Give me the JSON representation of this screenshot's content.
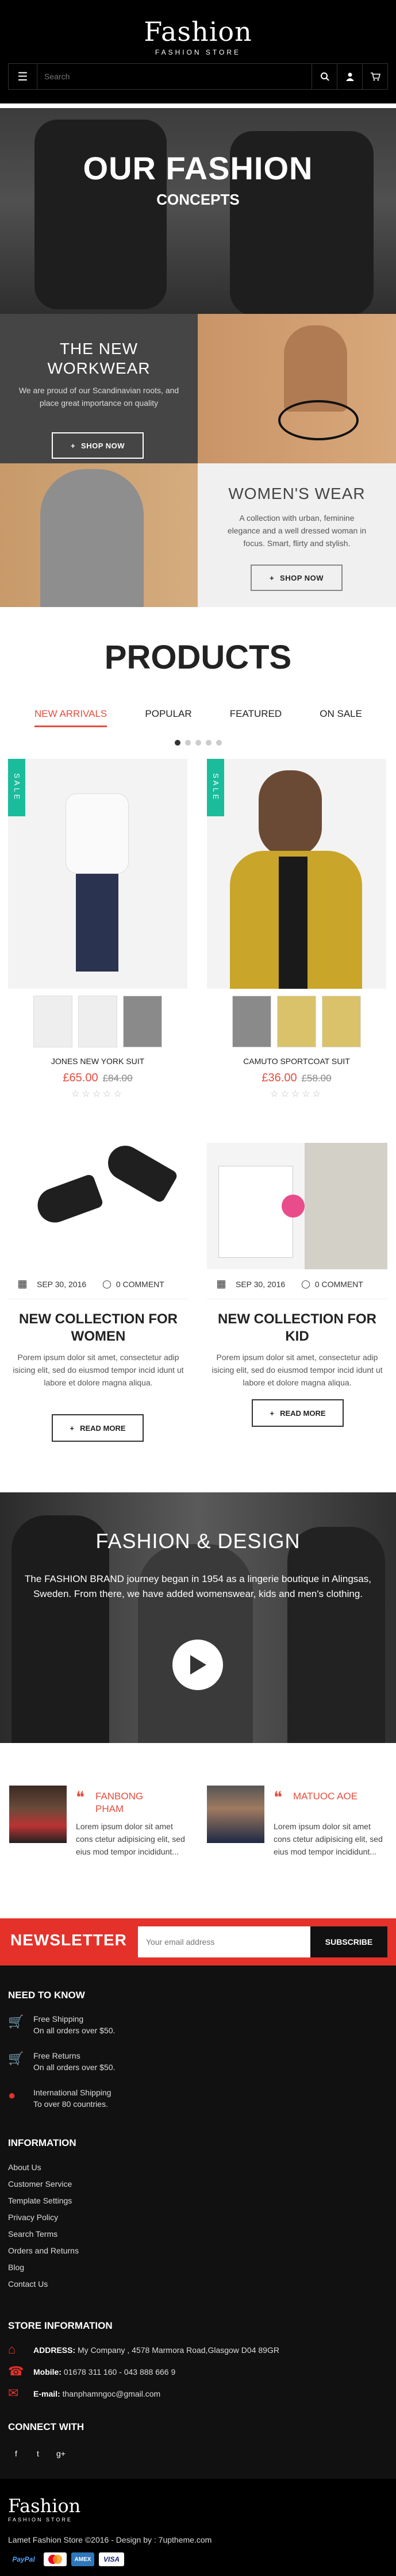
{
  "header": {
    "logo_word": "Fashion",
    "logo_sub": "FASHION STORE",
    "search_placeholder": "Search"
  },
  "hero": {
    "title": "OUR FASHION",
    "subtitle": "CONCEPTS"
  },
  "promo1": {
    "title_line1": "THE NEW",
    "title_line2": "WORKWEAR",
    "text": "We are proud of our Scandinavian roots, and place great importance on quality",
    "button": "SHOP NOW"
  },
  "promo2": {
    "title": "WOMEN'S WEAR",
    "text": "A collection with urban, feminine elegance and a well dressed woman in focus. Smart, flirty and stylish.",
    "button": "SHOP NOW"
  },
  "products": {
    "title": "PRODUCTS",
    "tabs": [
      "NEW ARRIVALS",
      "POPULAR",
      "FEATURED",
      "ON SALE"
    ],
    "sale_label": "SALE",
    "items": [
      {
        "name": "JONES NEW YORK SUIT",
        "price": "£65.00",
        "old_price": "£84.00"
      },
      {
        "name": "CAMUTO SPORTCOAT SUIT",
        "price": "£36.00",
        "old_price": "£58.00"
      }
    ],
    "stars": "☆☆☆☆☆"
  },
  "blog": [
    {
      "date": "SEP 30, 2016",
      "comments": "0 COMMENT",
      "title_line1": "NEW COLLECTION FOR",
      "title_line2": "WOMEN",
      "text": "Porem ipsum dolor sit amet, consectetur adip isicing elit, sed do eiusmod tempor incid idunt ut labore et dolore magna aliqua.",
      "button": "READ MORE"
    },
    {
      "date": "SEP 30, 2016",
      "comments": "0 COMMENT",
      "title_line1": "NEW COLLECTION FOR KID",
      "title_line2": "",
      "text": "Porem ipsum dolor sit amet, consectetur adip isicing elit, sed do eiusmod tempor incid idunt ut labore et dolore magna aliqua.",
      "button": "READ MORE"
    }
  ],
  "fashion_design": {
    "title": "FASHION & DESIGN",
    "text": "The FASHION BRAND journey began in 1954 as a lingerie boutique in Alingsas, Sweden. From there, we have added womenswear, kids and men's clothing."
  },
  "testimonials": [
    {
      "name_line1": "FANBONG",
      "name_line2": "PHAM",
      "text": "Lorem ipsum dolor sit amet cons ctetur adipisicing elit, sed eius mod tempor incididunt..."
    },
    {
      "name_line1": "MATUOC AOE",
      "name_line2": "",
      "text": "Lorem ipsum dolor sit amet cons ctetur adipisicing elit, sed eius mod tempor incididunt..."
    }
  ],
  "newsletter": {
    "label": "NEWSLETTER",
    "placeholder": "Your email address",
    "button": "SUBSCRIBE"
  },
  "footer": {
    "need_to_know": {
      "title": "NEED TO KNOW",
      "items": [
        {
          "line1": "Free Shipping",
          "line2": "On all orders over $50."
        },
        {
          "line1": "Free Returns",
          "line2": "On all orders over $50."
        },
        {
          "line1": "International Shipping",
          "line2": "To over 80 countries."
        }
      ]
    },
    "information": {
      "title": "INFORMATION",
      "links": [
        "About Us",
        "Customer Service",
        "Template Settings",
        "Privacy Policy",
        "Search Terms",
        "Orders and Returns",
        "Blog",
        "Contact Us"
      ]
    },
    "store": {
      "title": "STORE INFORMATION",
      "address_label": "ADDRESS:",
      "address": "My Company , 4578 Marmora Road,Glasgow D04 89GR",
      "mobile_label": "Mobile:",
      "mobile": "01678 311 160 - 043 888 666 9",
      "email_label": "E-mail:",
      "email": "thanphamngoc@gmail.com"
    },
    "connect": {
      "title": "CONNECT WITH",
      "icons": [
        "f",
        "t",
        "g+"
      ]
    },
    "bottom": {
      "logo_word": "Fashion",
      "logo_sub": "FASHION STORE",
      "copyright": "Lamet Fashion Store ©2016 - Design by : 7uptheme.com",
      "payments": [
        "PayPal",
        "mastercard",
        "AMEX",
        "VISA"
      ]
    }
  },
  "colors": {
    "accent": "#e4322b",
    "sale": "#1abc9c",
    "dark": "#111111"
  }
}
